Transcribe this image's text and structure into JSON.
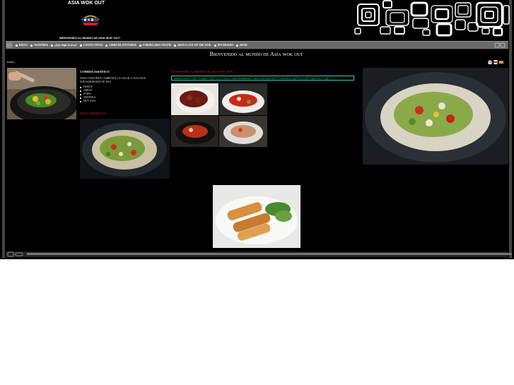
{
  "header": {
    "logo_title": "ASIA WOK OUT",
    "tagline": "BIENVENIDO AL MUNDO DE ASIA WOK OUT!"
  },
  "nav": {
    "items": [
      "INICIO",
      "NOSOTROS",
      "¿Que elegir la mesa?",
      "CONTACTENOS",
      "LIBRO DE INVITADOS",
      "FORMULARIO ONLINE",
      "RISICO LIVE ON THE WOK",
      "NOVEDADES",
      "MENU"
    ]
  },
  "page": {
    "title": "Bienvenido al mundo de Asia wok out",
    "breadcrumb": "INICIO"
  },
  "left_column": {
    "title": "COMIDA ASIATICO",
    "description": "TRAS CONOCER EL AMBIENTE LA COLOR, LOS PLATOS SON SABOROSOS DE ASIA",
    "menu": [
      "FIDEOS",
      "ARROZ",
      "SOPAS",
      "TEMPURA",
      "MUY ASIA"
    ],
    "new_heading": "NUEVO PRODUCTO!"
  },
  "center_column": {
    "heading": "BIENVENIDO AL MUNDO DE ASIA WOK OUT!",
    "embed_code": "<embed width=\"400\" height=\"300\" src=\"http://www.asiawokout.com/slideshow.swf\" flashvars=\"gallery.xml\" quality=\"high\" />"
  },
  "colors": {
    "background": "#000000",
    "nav_bar": "#6a6a6a",
    "heading_red": "#e02020",
    "embed_border": "#44cccc"
  },
  "icons": {
    "tools": [
      "print-icon",
      "pdf-icon",
      "email-icon"
    ]
  }
}
